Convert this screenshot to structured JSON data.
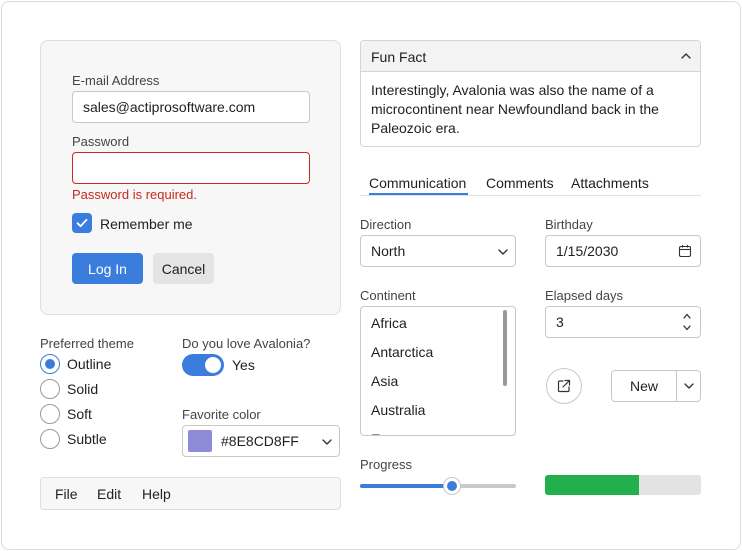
{
  "login": {
    "email_label": "E-mail Address",
    "email_value": "sales@actiprosoftware.com",
    "password_label": "Password",
    "password_value": "",
    "password_error": "Password is required.",
    "remember_label": "Remember me",
    "remember_checked": true,
    "login_button": "Log In",
    "cancel_button": "Cancel"
  },
  "theme": {
    "label": "Preferred theme",
    "options": [
      "Outline",
      "Solid",
      "Soft",
      "Subtle"
    ],
    "selected": "Outline"
  },
  "love": {
    "label": "Do you love Avalonia?",
    "value_text": "Yes",
    "on": true
  },
  "favorite_color": {
    "label": "Favorite color",
    "value": "#8E8CD8FF",
    "swatch": "#8E8CD8"
  },
  "menu": {
    "items": [
      "File",
      "Edit",
      "Help"
    ]
  },
  "fun_fact": {
    "title": "Fun Fact",
    "text": "Interestingly, Avalonia was also the name of a microcontinent near Newfoundland back in the Paleozoic era."
  },
  "tabs": {
    "items": [
      "Communication",
      "Comments",
      "Attachments"
    ],
    "selected": "Communication"
  },
  "direction": {
    "label": "Direction",
    "value": "North"
  },
  "birthday": {
    "label": "Birthday",
    "value": "1/15/2030"
  },
  "continent": {
    "label": "Continent",
    "items": [
      "Africa",
      "Antarctica",
      "Asia",
      "Australia",
      "Europe"
    ]
  },
  "elapsed_days": {
    "label": "Elapsed days",
    "value": "3"
  },
  "new_button": {
    "label": "New"
  },
  "progress": {
    "label": "Progress",
    "slider_value": 0.59,
    "bar_value": 0.6
  },
  "colors": {
    "accent": "#3b7ddd",
    "error": "#c42b1c",
    "progress_fill": "#21b04b",
    "progress_track": "#e3e3e3"
  }
}
